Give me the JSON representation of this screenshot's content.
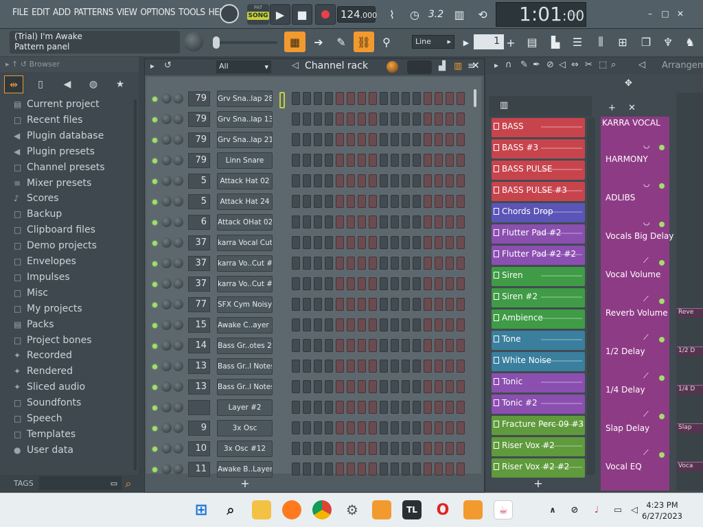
{
  "menu": [
    "FILE",
    "EDIT",
    "ADD",
    "PATTERNS",
    "VIEW",
    "OPTIONS",
    "TOOLS",
    "HELP"
  ],
  "transport": {
    "pat_label": "PAT",
    "song_label": "SONG",
    "tempo": "124",
    "tempo_frac": ".000"
  },
  "clock": {
    "main": "1:01",
    "sub": ":00",
    "bst": "B:S:T"
  },
  "hint": {
    "line1": "(Trial) I'm Awake",
    "line2": "Pattern panel"
  },
  "snap": {
    "value": "Line"
  },
  "pattern_number": "1",
  "browser": {
    "title": "Browser",
    "items": [
      {
        "icon": "▤",
        "label": "Current project"
      },
      {
        "icon": "□",
        "label": "Recent files"
      },
      {
        "icon": "◀",
        "label": "Plugin database"
      },
      {
        "icon": "◀",
        "label": "Plugin presets"
      },
      {
        "icon": "□",
        "label": "Channel presets"
      },
      {
        "icon": "≡",
        "label": "Mixer presets"
      },
      {
        "icon": "♪",
        "label": "Scores"
      },
      {
        "icon": "□",
        "label": "Backup"
      },
      {
        "icon": "□",
        "label": "Clipboard files"
      },
      {
        "icon": "□",
        "label": "Demo projects"
      },
      {
        "icon": "□",
        "label": "Envelopes"
      },
      {
        "icon": "□",
        "label": "Impulses"
      },
      {
        "icon": "□",
        "label": "Misc"
      },
      {
        "icon": "□",
        "label": "My projects"
      },
      {
        "icon": "▤",
        "label": "Packs"
      },
      {
        "icon": "□",
        "label": "Project bones"
      },
      {
        "icon": "✦",
        "label": "Recorded"
      },
      {
        "icon": "✦",
        "label": "Rendered"
      },
      {
        "icon": "✦",
        "label": "Sliced audio"
      },
      {
        "icon": "□",
        "label": "Soundfonts"
      },
      {
        "icon": "□",
        "label": "Speech"
      },
      {
        "icon": "□",
        "label": "Templates"
      },
      {
        "icon": "●",
        "label": "User data"
      }
    ],
    "tags_label": "TAGS"
  },
  "channel_rack": {
    "title": "Channel rack",
    "filter": "All",
    "channels": [
      {
        "mix": "79",
        "name": "Grv Sna..lap 28"
      },
      {
        "mix": "79",
        "name": "Grv Sna..lap 13"
      },
      {
        "mix": "79",
        "name": "Grv Sna..lap 21"
      },
      {
        "mix": "79",
        "name": "Linn Snare"
      },
      {
        "mix": "5",
        "name": "Attack Hat 02"
      },
      {
        "mix": "5",
        "name": "Attack Hat 24"
      },
      {
        "mix": "6",
        "name": "Attack OHat 02"
      },
      {
        "mix": "37",
        "name": "karra Vocal Cut"
      },
      {
        "mix": "37",
        "name": "karra Vo..Cut #2"
      },
      {
        "mix": "37",
        "name": "karra Vo..Cut #3"
      },
      {
        "mix": "77",
        "name": "SFX Cym Noisy"
      },
      {
        "mix": "15",
        "name": "Awake C..ayer 2"
      },
      {
        "mix": "14",
        "name": "Bass Gr..otes 2"
      },
      {
        "mix": "13",
        "name": "Bass Gr..l Notes"
      },
      {
        "mix": "13",
        "name": "Bass Gr..l Notes"
      },
      {
        "mix": "",
        "name": "Layer #2"
      },
      {
        "mix": "9",
        "name": "3x Osc"
      },
      {
        "mix": "10",
        "name": "3x Osc #12"
      },
      {
        "mix": "11",
        "name": "Awake B..Layer"
      }
    ]
  },
  "playlist": {
    "title": "Arrangem",
    "patterns": [
      {
        "label": "BASS",
        "color": "#c8444d"
      },
      {
        "label": "BASS #3",
        "color": "#c8444d"
      },
      {
        "label": "BASS PULSE",
        "color": "#c8444d"
      },
      {
        "label": "BASS PULSE #3",
        "color": "#c8444d"
      },
      {
        "label": "Chords  Drop",
        "color": "#5b55b8"
      },
      {
        "label": "Flutter Pad #2",
        "color": "#8b4fb0"
      },
      {
        "label": "Flutter Pad #2 #2",
        "color": "#8b4fb0"
      },
      {
        "label": "Siren",
        "color": "#3f9b45"
      },
      {
        "label": "Siren #2",
        "color": "#3f9b45"
      },
      {
        "label": "Ambience",
        "color": "#3f9b45"
      },
      {
        "label": "Tone",
        "color": "#3a7f9d"
      },
      {
        "label": "White Noise",
        "color": "#3a7f9d"
      },
      {
        "label": "Tonic",
        "color": "#8b4fb0"
      },
      {
        "label": "Tonic #2",
        "color": "#8b4fb0"
      },
      {
        "label": "Fracture Perc 09 #3",
        "color": "#5f9a3c"
      },
      {
        "label": "Riser Vox #2",
        "color": "#5f9a3c"
      },
      {
        "label": "Riser Vox #2 #2",
        "color": "#5f9a3c"
      }
    ],
    "automation": [
      "KARRA VOCAL",
      "HARMONY",
      "ADLIBS",
      "Vocals Big Delay",
      "Vocal Volume",
      "Reverb Volume",
      "1/2 Delay",
      "1/4 Delay",
      "Slap Delay",
      "Vocal EQ"
    ],
    "clips": [
      "Reve",
      "1/2 D",
      "1/4 D",
      "Slap",
      "Voca"
    ]
  },
  "taskbar": {
    "time": "4:23 PM",
    "date": "6/27/2023"
  }
}
